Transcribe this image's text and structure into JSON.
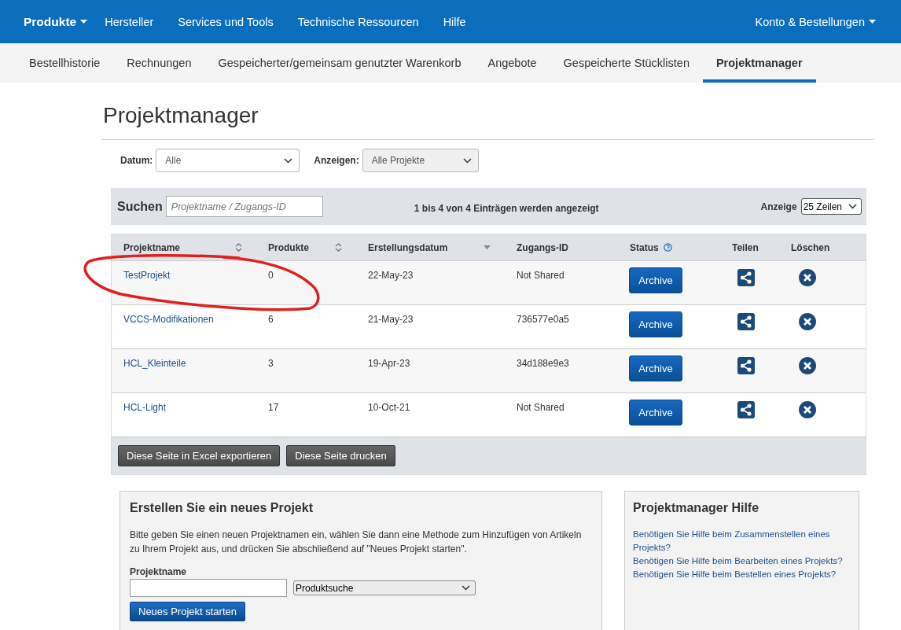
{
  "top_nav": {
    "items": [
      {
        "label": "Produkte",
        "kind": "primary",
        "dropdown": true
      },
      {
        "label": "Hersteller",
        "kind": "link",
        "dropdown": false
      },
      {
        "label": "Services und Tools",
        "kind": "link",
        "dropdown": false
      },
      {
        "label": "Technische Ressourcen",
        "kind": "link",
        "dropdown": false
      },
      {
        "label": "Hilfe",
        "kind": "link",
        "dropdown": false
      }
    ],
    "account": {
      "label": "Konto & Bestellungen",
      "dropdown": true
    }
  },
  "tabs": [
    {
      "label": "Bestellhistorie",
      "selected": false
    },
    {
      "label": "Rechnungen",
      "selected": false
    },
    {
      "label": "Gespeicherter/gemeinsam genutzter Warenkorb",
      "selected": false
    },
    {
      "label": "Angebote",
      "selected": false
    },
    {
      "label": "Gespeicherte Stücklisten",
      "selected": false
    },
    {
      "label": "Projektmanager",
      "selected": true
    }
  ],
  "page_title": "Projektmanager",
  "filters": [
    {
      "label": "Datum:",
      "value": "Alle",
      "disabled": false
    },
    {
      "label": "Anzeigen:",
      "value": "Alle Projekte",
      "disabled": true
    }
  ],
  "search": {
    "label": "Suchen",
    "placeholder": "Projektname / Zugangs-ID"
  },
  "info": "1 bis 4 von 4 Einträgen werden angezeigt",
  "page_size": {
    "label": "Anzeige",
    "value": "25 Zeilen"
  },
  "table": {
    "columns": [
      {
        "label": "Projektname",
        "sortable": true,
        "sorted": false,
        "help": false
      },
      {
        "label": "Produkte",
        "sortable": true,
        "sorted": false,
        "help": false
      },
      {
        "label": "Erstellungsdatum",
        "sortable": true,
        "sorted": true,
        "help": false
      },
      {
        "label": "Zugangs-ID"
      },
      {
        "label": "Status",
        "help": true
      },
      {
        "label": "Teilen"
      },
      {
        "label": "Löschen"
      }
    ],
    "rows": [
      {
        "name": "TestProjekt",
        "products": "0",
        "created": "22-May-23",
        "access_id": "Not Shared",
        "status_button": "Archive"
      },
      {
        "name": "VCCS-Modifikationen",
        "products": "6",
        "created": "21-May-23",
        "access_id": "736577e0a5",
        "status_button": "Archive"
      },
      {
        "name": "HCL_Kleinteile",
        "products": "3",
        "created": "19-Apr-23",
        "access_id": "34d188e9e3",
        "status_button": "Archive"
      },
      {
        "name": "HCL-Light",
        "products": "17",
        "created": "10-Oct-21",
        "access_id": "Not Shared",
        "status_button": "Archive"
      }
    ],
    "annotation": {
      "kind": "circle",
      "color": "#e02020"
    },
    "buttons": [
      "Diese Seite in Excel exportieren",
      "Diese Seite drucken"
    ]
  },
  "new_project": {
    "title": "Erstellen Sie ein neues Projekt",
    "text": "Bitte geben Sie einen neuen Projektnamen ein, wählen Sie dann eine Methode zum Hinzufügen von Artikeln zu Ihrem Projekt aus, und drücken Sie abschließend auf \"Neues Projekt starten\".",
    "name_label": "Projektname",
    "method": "Produktsuche",
    "submit": "Neues Projekt starten"
  },
  "help": {
    "title": "Projektmanager Hilfe",
    "links": [
      "Benötigen Sie Hilfe beim Zusammenstellen eines Projekts?",
      "Benötigen Sie Hilfe beim Bearbeiten eines Projekts?",
      "Benötigen Sie Hilfe beim Bestellen eines Projekts?"
    ]
  }
}
